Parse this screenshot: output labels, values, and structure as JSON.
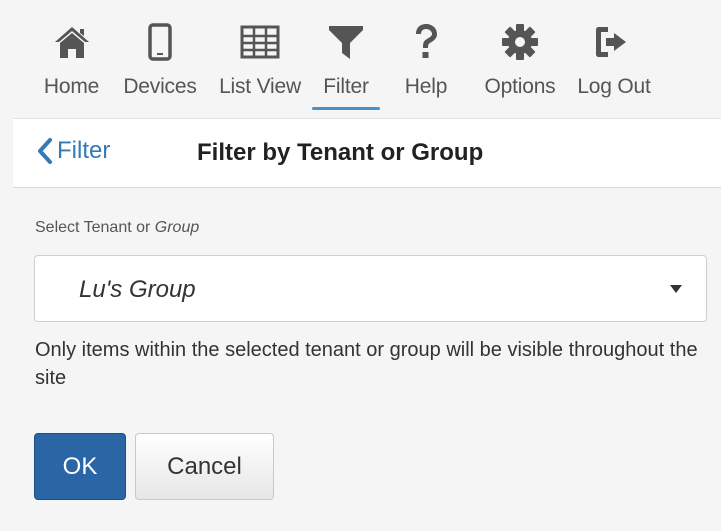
{
  "nav": {
    "items": [
      {
        "label": "Home",
        "icon": "home-icon"
      },
      {
        "label": "Devices",
        "icon": "devices-icon"
      },
      {
        "label": "List View",
        "icon": "list-view-icon"
      },
      {
        "label": "Filter",
        "icon": "filter-icon",
        "active": true
      },
      {
        "label": "Help",
        "icon": "help-icon"
      },
      {
        "label": "Options",
        "icon": "gear-icon"
      },
      {
        "label": "Log Out",
        "icon": "logout-icon"
      }
    ],
    "active_color": "#4a90c8",
    "icon_color": "#555555"
  },
  "header": {
    "back_label": "Filter",
    "title": "Filter by Tenant or Group"
  },
  "form": {
    "label_prefix": "Select Tenant or ",
    "label_emphasis": "Group",
    "selected_value": "Lu's Group",
    "help_text": "Only items within the selected tenant or group will be visible throughout the site"
  },
  "buttons": {
    "ok_label": "OK",
    "cancel_label": "Cancel",
    "ok_color": "#2a65a6"
  }
}
